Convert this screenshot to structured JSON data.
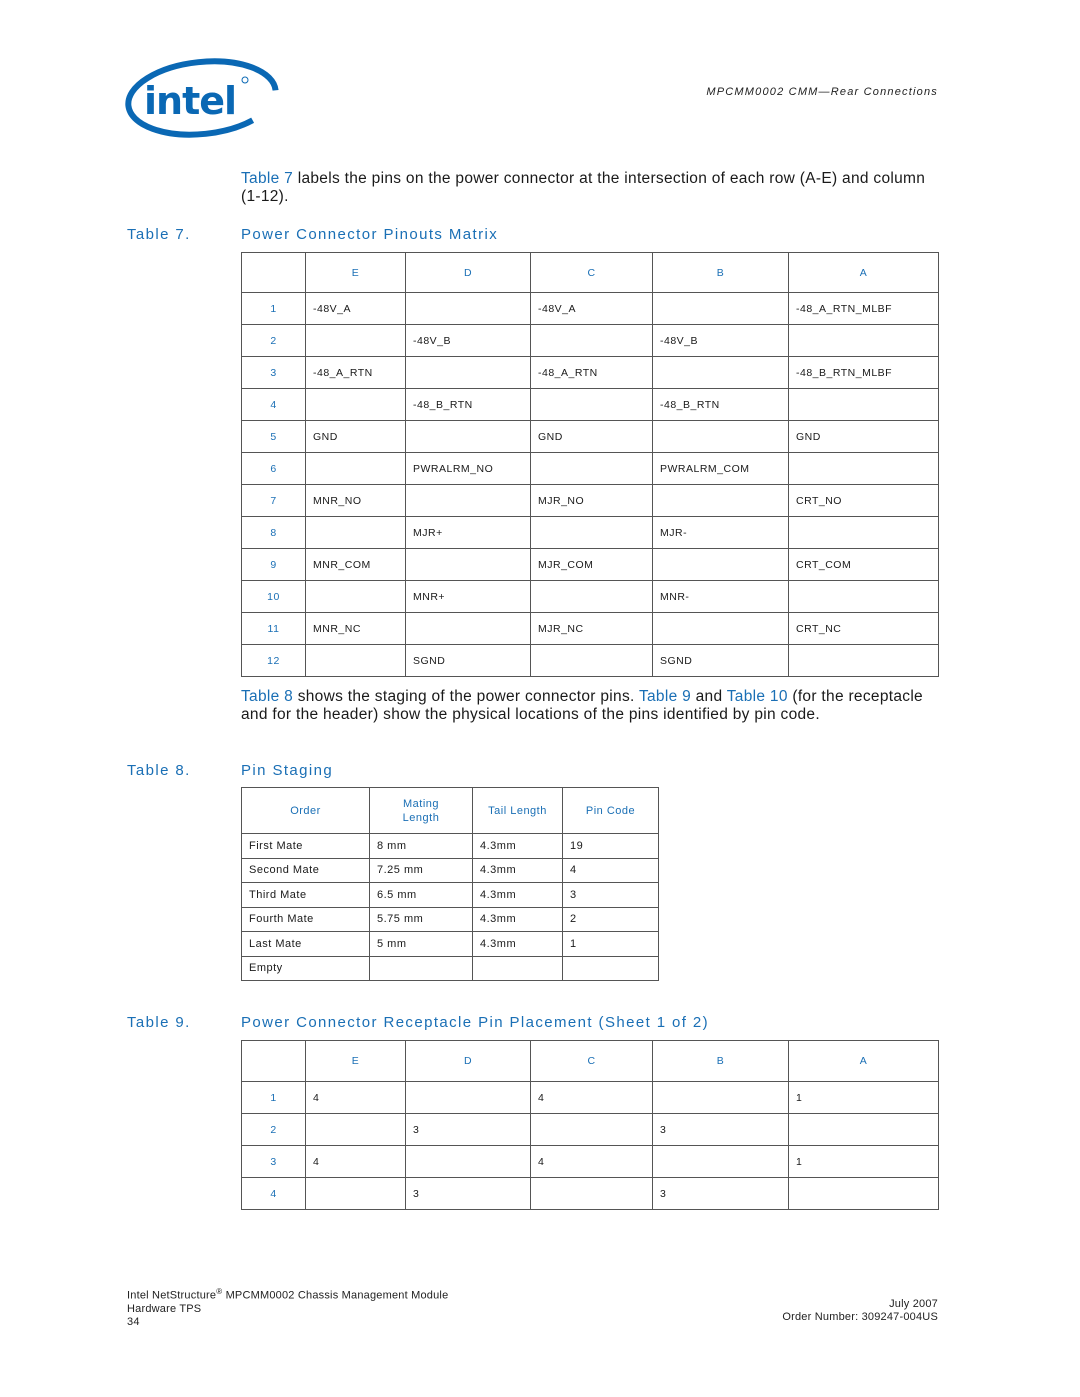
{
  "header": {
    "logo_text": "intel",
    "running_title": "MPCMM0002 CMM—Rear Connections"
  },
  "intro7": {
    "link": "Table 7",
    "text": " labels the pins on the power connector at the intersection of each row (A-E) and column (1-12)."
  },
  "table7": {
    "number": "Table 7.",
    "title": "Power Connector Pinouts Matrix",
    "columns": [
      "",
      "E",
      "D",
      "C",
      "B",
      "A"
    ],
    "rows": [
      {
        "row": "1",
        "cells": [
          "-48V_A",
          "",
          "-48V_A",
          "",
          "-48_A_RTN_MLBF"
        ]
      },
      {
        "row": "2",
        "cells": [
          "",
          "-48V_B",
          "",
          "-48V_B",
          ""
        ]
      },
      {
        "row": "3",
        "cells": [
          "-48_A_RTN",
          "",
          "-48_A_RTN",
          "",
          "-48_B_RTN_MLBF"
        ]
      },
      {
        "row": "4",
        "cells": [
          "",
          "-48_B_RTN",
          "",
          "-48_B_RTN",
          ""
        ]
      },
      {
        "row": "5",
        "cells": [
          "GND",
          "",
          "GND",
          "",
          "GND"
        ]
      },
      {
        "row": "6",
        "cells": [
          "",
          "PWRALRM_NO",
          "",
          "PWRALRM_COM",
          ""
        ]
      },
      {
        "row": "7",
        "cells": [
          "MNR_NO",
          "",
          "MJR_NO",
          "",
          "CRT_NO"
        ]
      },
      {
        "row": "8",
        "cells": [
          "",
          "MJR+",
          "",
          "MJR-",
          ""
        ]
      },
      {
        "row": "9",
        "cells": [
          "MNR_COM",
          "",
          "MJR_COM",
          "",
          "CRT_COM"
        ]
      },
      {
        "row": "10",
        "cells": [
          "",
          "MNR+",
          "",
          "MNR-",
          ""
        ]
      },
      {
        "row": "11",
        "cells": [
          "MNR_NC",
          "",
          "MJR_NC",
          "",
          "CRT_NC"
        ]
      },
      {
        "row": "12",
        "cells": [
          "",
          "SGND",
          "",
          "SGND",
          ""
        ]
      }
    ]
  },
  "intro8": {
    "link1": "Table 8",
    "text1": " shows the staging of the power connector pins. ",
    "link2": "Table 9",
    "text2": " and ",
    "link3": "Table 10",
    "text3": " (for the receptacle and for the header) show the physical locations of the pins identified by pin code."
  },
  "table8": {
    "number": "Table 8.",
    "title": "Pin Staging",
    "columns": [
      "Order",
      "Mating Length",
      "Tail Length",
      "Pin Code"
    ],
    "rows": [
      [
        "First Mate",
        "8 mm",
        "4.3mm",
        "19"
      ],
      [
        "Second Mate",
        "7.25 mm",
        "4.3mm",
        "4"
      ],
      [
        "Third Mate",
        "6.5 mm",
        "4.3mm",
        "3"
      ],
      [
        "Fourth Mate",
        "5.75 mm",
        "4.3mm",
        "2"
      ],
      [
        "Last Mate",
        "5 mm",
        "4.3mm",
        "1"
      ],
      [
        "Empty",
        "",
        "",
        ""
      ]
    ]
  },
  "table9": {
    "number": "Table 9.",
    "title": "Power Connector Receptacle Pin Placement (Sheet 1 of 2)",
    "columns": [
      "",
      "E",
      "D",
      "C",
      "B",
      "A"
    ],
    "rows": [
      {
        "row": "1",
        "cells": [
          "4",
          "",
          "4",
          "",
          "1"
        ]
      },
      {
        "row": "2",
        "cells": [
          "",
          "3",
          "",
          "3",
          ""
        ]
      },
      {
        "row": "3",
        "cells": [
          "4",
          "",
          "4",
          "",
          "1"
        ]
      },
      {
        "row": "4",
        "cells": [
          "",
          "3",
          "",
          "3",
          ""
        ]
      }
    ]
  },
  "footer": {
    "product_prefix": "Intel NetStructure",
    "registered": "®",
    "product_suffix": " MPCMM0002 Chassis Management Module",
    "doc_type": "Hardware TPS",
    "page_number": "34",
    "date": "July 2007",
    "order_number": "Order Number: 309247-004US"
  },
  "colors": {
    "accent": "#1a6fb5",
    "text": "#1a1a1a",
    "border": "#555555"
  }
}
